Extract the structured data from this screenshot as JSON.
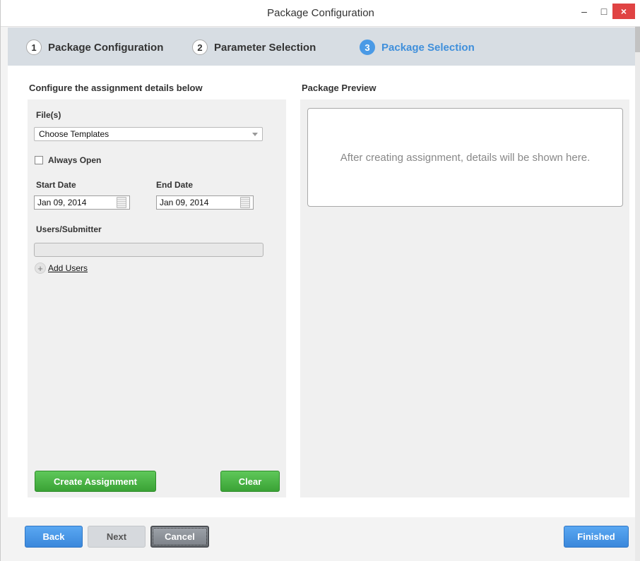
{
  "window": {
    "title": "Package Configuration",
    "minimize": "–",
    "maximize": "□",
    "close": "×"
  },
  "steps": [
    {
      "num": "1",
      "label": "Package Configuration"
    },
    {
      "num": "2",
      "label": "Parameter Selection"
    },
    {
      "num": "3",
      "label": "Package Selection"
    }
  ],
  "left": {
    "title": "Configure the assignment details below",
    "files_label": "File(s)",
    "files_value": "Choose Templates",
    "always_open": "Always Open",
    "start_label": "Start Date",
    "start_value": "Jan 09, 2014",
    "end_label": "End Date",
    "end_value": "Jan 09, 2014",
    "users_label": "Users/Submitter",
    "add_users": "Add Users",
    "add_icon": "+",
    "create_btn": "Create Assignment",
    "clear_btn": "Clear"
  },
  "right": {
    "title": "Package Preview",
    "preview_text": "After creating assignment, details will be shown here."
  },
  "footer": {
    "back": "Back",
    "next": "Next",
    "cancel": "Cancel",
    "finished": "Finished"
  },
  "colors": {
    "accent": "#4a9ae6",
    "green": "#3aa235",
    "close_red": "#e04343"
  }
}
